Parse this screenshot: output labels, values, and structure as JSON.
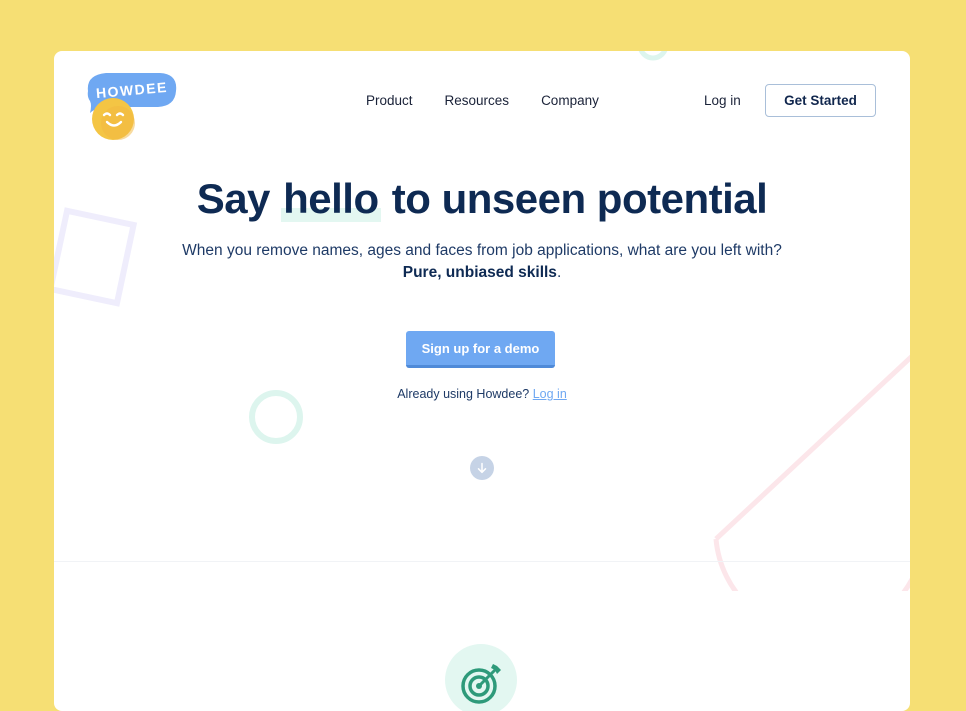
{
  "brand": {
    "name": "HOWDEE"
  },
  "nav": {
    "items": [
      {
        "label": "Product"
      },
      {
        "label": "Resources"
      },
      {
        "label": "Company"
      }
    ],
    "login_label": "Log in",
    "cta_label": "Get Started"
  },
  "hero": {
    "title_before": "Say ",
    "title_highlight": "hello",
    "title_after": " to unseen potential",
    "subtitle_line1": "When you remove names, ages and faces from job applications, what are you left with?",
    "subtitle_strong": "Pure, unbiased skills",
    "subtitle_end": ".",
    "demo_button": "Sign up for a demo",
    "already_text": "Already using Howdee? ",
    "already_link": "Log in"
  },
  "icons": {
    "scroll": "arrow-down-icon",
    "feature": "target-icon"
  },
  "colors": {
    "background": "#F6DF74",
    "primary": "#6FA8F2",
    "heading": "#0E2A53",
    "highlight": "#E3F7F1"
  }
}
